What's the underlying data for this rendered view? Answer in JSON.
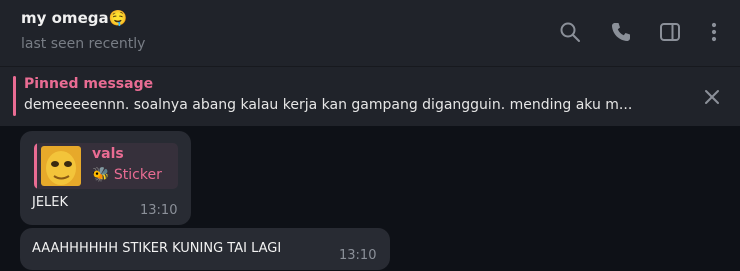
{
  "header": {
    "title": "my omega",
    "title_emoji": "🤤",
    "status": "last seen recently",
    "icons": [
      "search-icon",
      "phone-icon",
      "sidebar-toggle-icon",
      "more-vertical-icon"
    ]
  },
  "pinned": {
    "label": "Pinned message",
    "text": "demeeeeennn. soalnya abang kalau kerja kan gampang digangguin. mending aku m..."
  },
  "messages": [
    {
      "reply": {
        "author": "vals",
        "emoji": "🐝",
        "kind": "Sticker"
      },
      "text": "JELEK",
      "time": "13:10"
    },
    {
      "text": "AAAHHHHHH STIKER KUNING TAI LAGI",
      "time": "13:10"
    }
  ],
  "colors": {
    "background": "#0e1117",
    "header": "#20232a",
    "bubble": "#282b33",
    "accent": "#e96c93"
  }
}
